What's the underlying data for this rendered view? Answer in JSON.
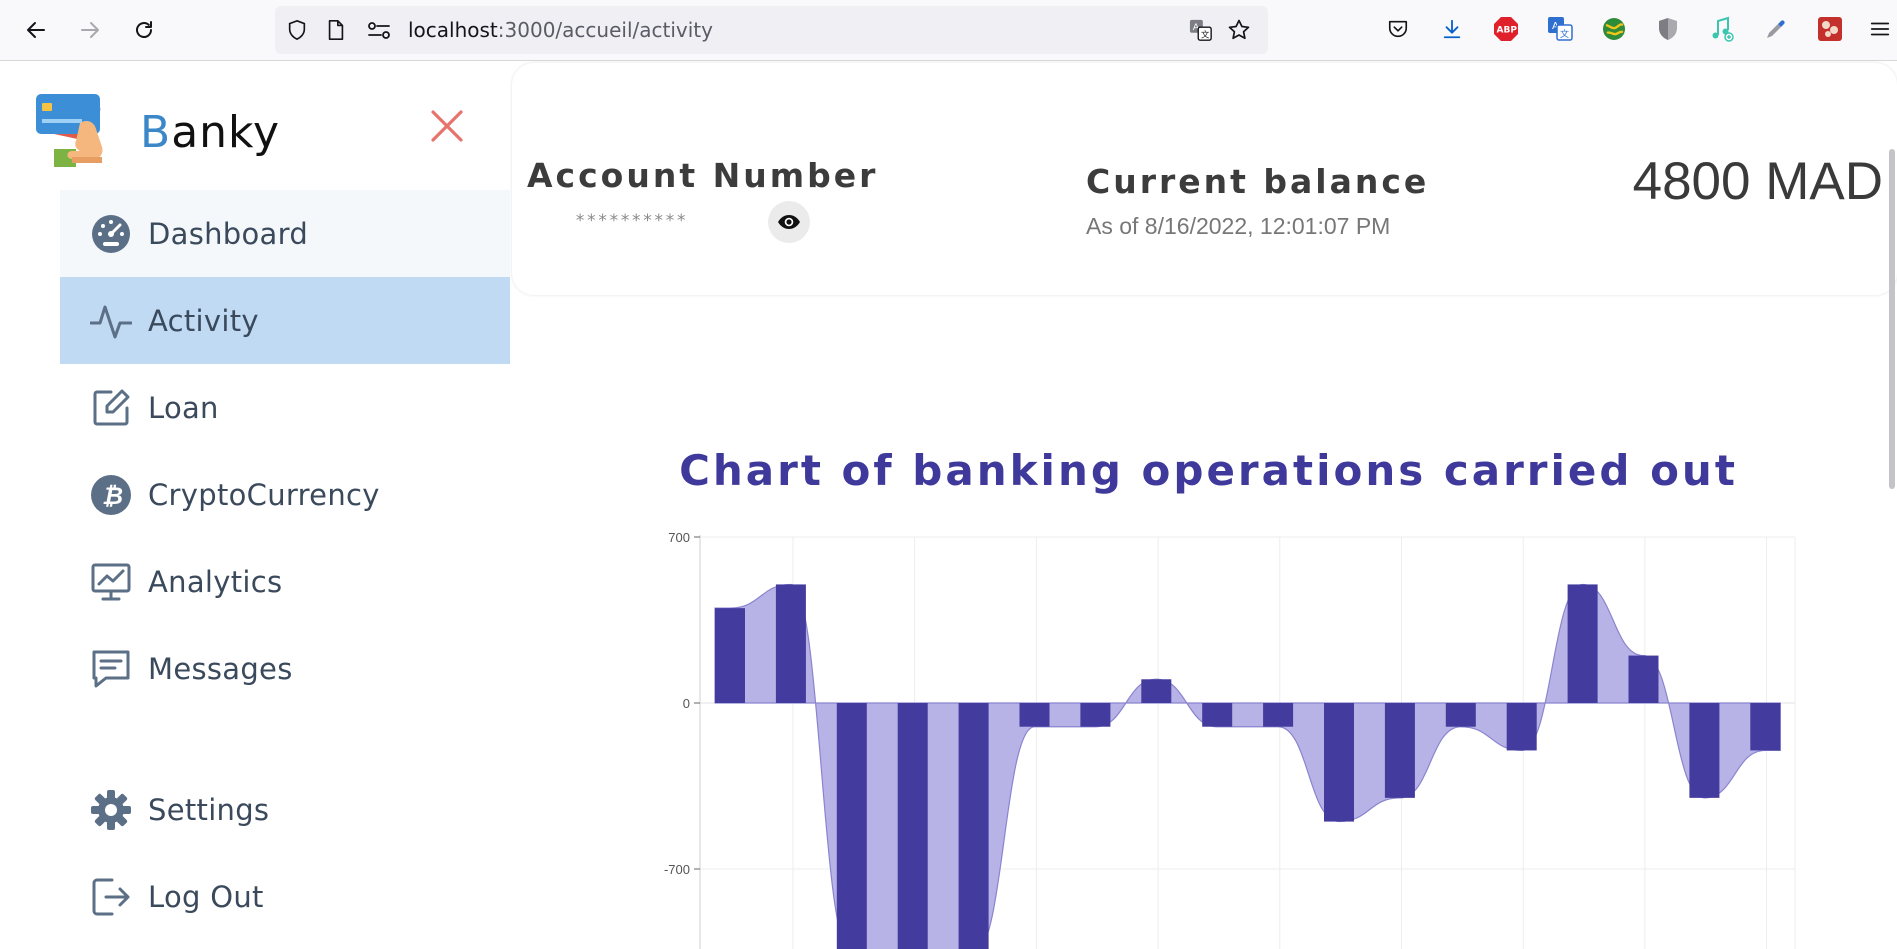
{
  "browser": {
    "url_host": "localhost",
    "url_path": ":3000/accueil/activity"
  },
  "sidebar": {
    "brand_initial": "B",
    "brand_rest": "anky",
    "items": [
      {
        "label": "Dashboard",
        "icon": "dashboard-gauge-icon"
      },
      {
        "label": "Activity",
        "icon": "activity-pulse-icon",
        "active": true
      },
      {
        "label": "Loan",
        "icon": "edit-icon"
      },
      {
        "label": "CryptoCurrency",
        "icon": "bitcoin-icon"
      },
      {
        "label": "Analytics",
        "icon": "presentation-chart-icon"
      },
      {
        "label": "Messages",
        "icon": "message-icon"
      },
      {
        "label": "Settings",
        "icon": "gear-icon"
      },
      {
        "label": "Log Out",
        "icon": "logout-icon"
      }
    ]
  },
  "account": {
    "label": "Account Number",
    "masked_number": "**********",
    "balance_label": "Current balance",
    "balance_date": "As of 8/16/2022, 12:01:07 PM",
    "balance_amount": "4800 MAD"
  },
  "chart": {
    "title": "Chart of banking operations carried out"
  },
  "chart_data": {
    "type": "bar",
    "title": "Chart of banking operations carried out",
    "xlabel": "",
    "ylabel": "",
    "yticks": [
      "700",
      "0",
      "-700"
    ],
    "ytick_values": [
      700,
      0,
      -700
    ],
    "ylim": [
      -1040,
      700
    ],
    "grid": true,
    "area_fill": true,
    "values": [
      400,
      500,
      -1400,
      -1400,
      -1400,
      -100,
      -100,
      100,
      -100,
      -100,
      -500,
      -400,
      -100,
      -200,
      500,
      200,
      -400,
      -200
    ],
    "colors": {
      "bar": "#433b9e",
      "area": "#b7b3e6",
      "area_line": "#8a84cf",
      "grid": "#ededed",
      "zero": "#e2e2e2"
    }
  }
}
